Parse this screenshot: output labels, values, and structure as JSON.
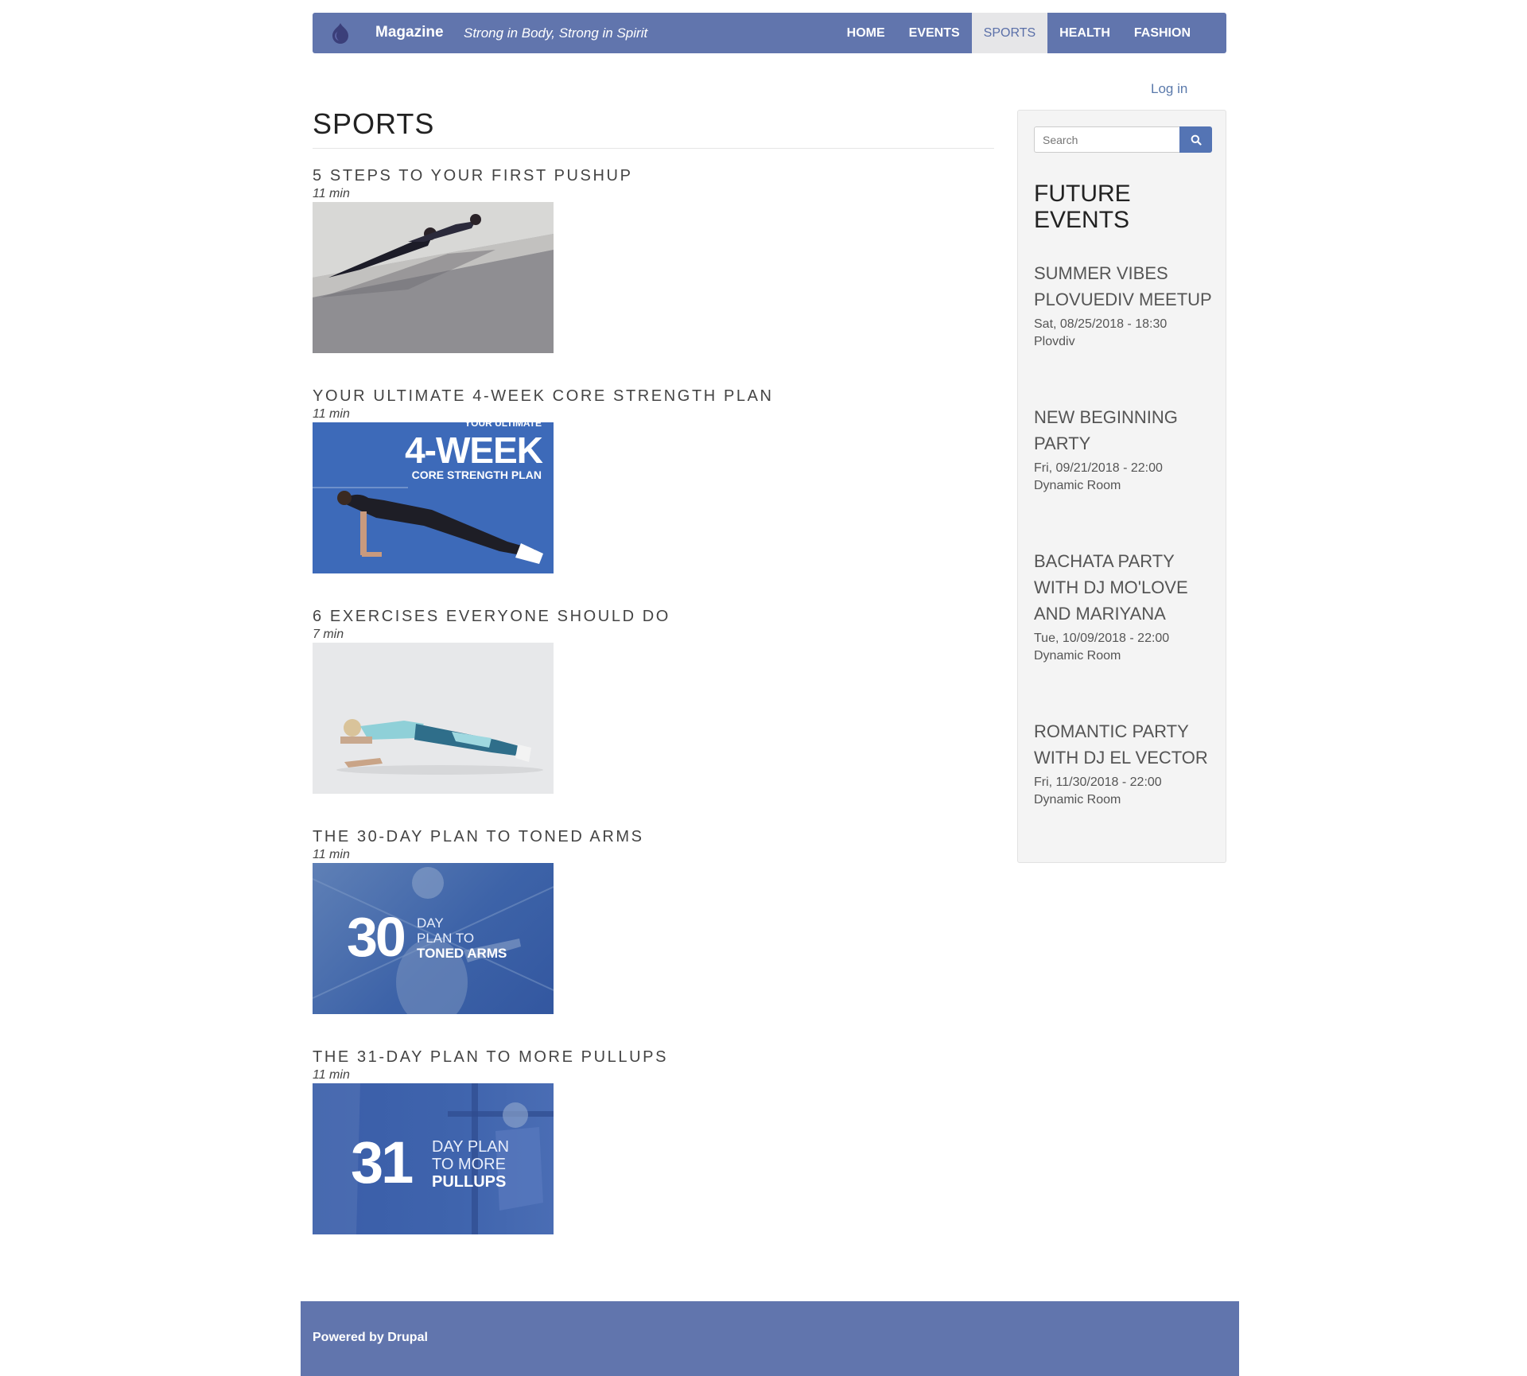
{
  "header": {
    "site_name": "Magazine",
    "slogan": "Strong in Body, Strong in Spirit",
    "nav": [
      {
        "label": "HOME"
      },
      {
        "label": "EVENTS"
      },
      {
        "label": "SPORTS",
        "active": true
      },
      {
        "label": "HEALTH"
      },
      {
        "label": "FASHION"
      }
    ]
  },
  "user": {
    "login_label": "Log in"
  },
  "main": {
    "title": "SPORTS",
    "articles": [
      {
        "title": "5 STEPS TO YOUR FIRST PUSHUP",
        "time": "11 min",
        "image_icon": "pushup-photo"
      },
      {
        "title": "YOUR ULTIMATE 4-WEEK CORE STRENGTH PLAN",
        "time": "11 min",
        "image_icon": "plank-photo",
        "image_text": {
          "top": "YOUR ULTIMATE",
          "big": "4-WEEK",
          "small": "CORE STRENGTH PLAN"
        }
      },
      {
        "title": "6 EXERCISES EVERYONE SHOULD DO",
        "time": "7 min",
        "image_icon": "forearm-plank-photo"
      },
      {
        "title": "THE 30-DAY PLAN TO TONED ARMS",
        "time": "11 min",
        "image_icon": "arms-photo",
        "image_text": {
          "num": "30",
          "l1": "DAY",
          "l2": "PLAN TO",
          "l3": "TONED ARMS"
        }
      },
      {
        "title": "THE 31-DAY PLAN TO MORE PULLUPS",
        "time": "11 min",
        "image_icon": "pullup-photo",
        "image_text": {
          "num": "31",
          "l1": "DAY PLAN",
          "l2": "TO MORE",
          "l3": "PULLUPS"
        }
      }
    ]
  },
  "sidebar": {
    "search_placeholder": "Search",
    "block_title": "FUTURE EVENTS",
    "events": [
      {
        "title": "SUMMER VIBES PLOVUEDIV MEETUP",
        "date": "Sat, 08/25/2018 - 18:30",
        "location": "Plovdiv"
      },
      {
        "title": "NEW BEGINNING PARTY",
        "date": "Fri, 09/21/2018 - 22:00",
        "location": "Dynamic Room"
      },
      {
        "title": "BACHATA PARTY WITH DJ MO'LOVE AND MARIYANA",
        "date": "Tue, 10/09/2018 - 22:00",
        "location": "Dynamic Room"
      },
      {
        "title": "ROMANTIC PARTY WITH DJ EL VECTOR",
        "date": "Fri, 11/30/2018 - 22:00",
        "location": "Dynamic Room"
      }
    ]
  },
  "footer": {
    "text": "Powered by Drupal"
  },
  "colors": {
    "brand": "#6175ad",
    "accent": "#5474b4"
  }
}
